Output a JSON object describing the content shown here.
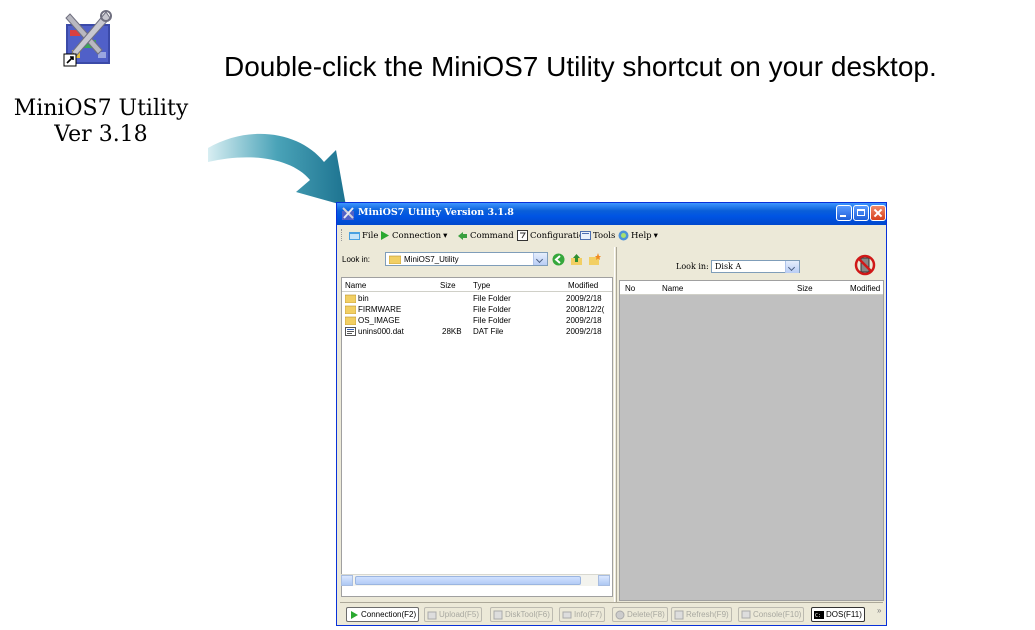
{
  "shortcut": {
    "icon": "miniOS7-utility-tools-icon",
    "label_line1": "MiniOS7 Utility",
    "label_line2": "Ver 3.18"
  },
  "instruction": "Double-click the MiniOS7 Utility shortcut on your desktop.",
  "window": {
    "title": "MiniOS7 Utility Version 3.1.8",
    "menu": [
      {
        "label": "File",
        "icon": "folder-icon"
      },
      {
        "label": "Connection",
        "icon": "play-icon",
        "dropdown": true
      },
      {
        "label": "Command",
        "icon": "command-icon"
      },
      {
        "label": "Configuration",
        "icon": "config-icon"
      },
      {
        "label": "Tools",
        "icon": "tools-icon"
      },
      {
        "label": "Help",
        "icon": "help-icon",
        "dropdown": true
      }
    ],
    "left": {
      "look_in_label": "Look in:",
      "look_in_value": "MiniOS7_Utility",
      "columns": [
        "Name",
        "Size",
        "Type",
        "Modified"
      ],
      "rows": [
        {
          "name": "bin",
          "size": "",
          "type": "File Folder",
          "modified": "2009/2/18",
          "icon": "folder-icon"
        },
        {
          "name": "FIRMWARE",
          "size": "",
          "type": "File Folder",
          "modified": "2008/12/2(",
          "icon": "folder-icon"
        },
        {
          "name": "OS_IMAGE",
          "size": "",
          "type": "File Folder",
          "modified": "2009/2/18",
          "icon": "folder-icon"
        },
        {
          "name": "unins000.dat",
          "size": "28KB",
          "type": "DAT File",
          "modified": "2009/2/18",
          "icon": "dat-file-icon"
        }
      ]
    },
    "right": {
      "look_in_label": "Look in:",
      "look_in_value": "Disk A",
      "columns": [
        "No",
        "Name",
        "Size",
        "Modified"
      ]
    },
    "bottom": [
      {
        "label": "Connection(F2)",
        "enabled": true,
        "icon": "play-icon"
      },
      {
        "label": "Upload(F5)",
        "enabled": false,
        "icon": "upload-icon"
      },
      {
        "label": "DiskTool(F6)",
        "enabled": false,
        "icon": "disktool-icon"
      },
      {
        "label": "Info(F7)",
        "enabled": false,
        "icon": "info-icon"
      },
      {
        "label": "Delete(F8)",
        "enabled": false,
        "icon": "delete-icon"
      },
      {
        "label": "Refresh(F9)",
        "enabled": false,
        "icon": "refresh-icon"
      },
      {
        "label": "Console(F10)",
        "enabled": false,
        "icon": "console-icon"
      },
      {
        "label": "DOS(F11)",
        "enabled": true,
        "icon": "dos-icon"
      }
    ],
    "overflow": "»"
  }
}
